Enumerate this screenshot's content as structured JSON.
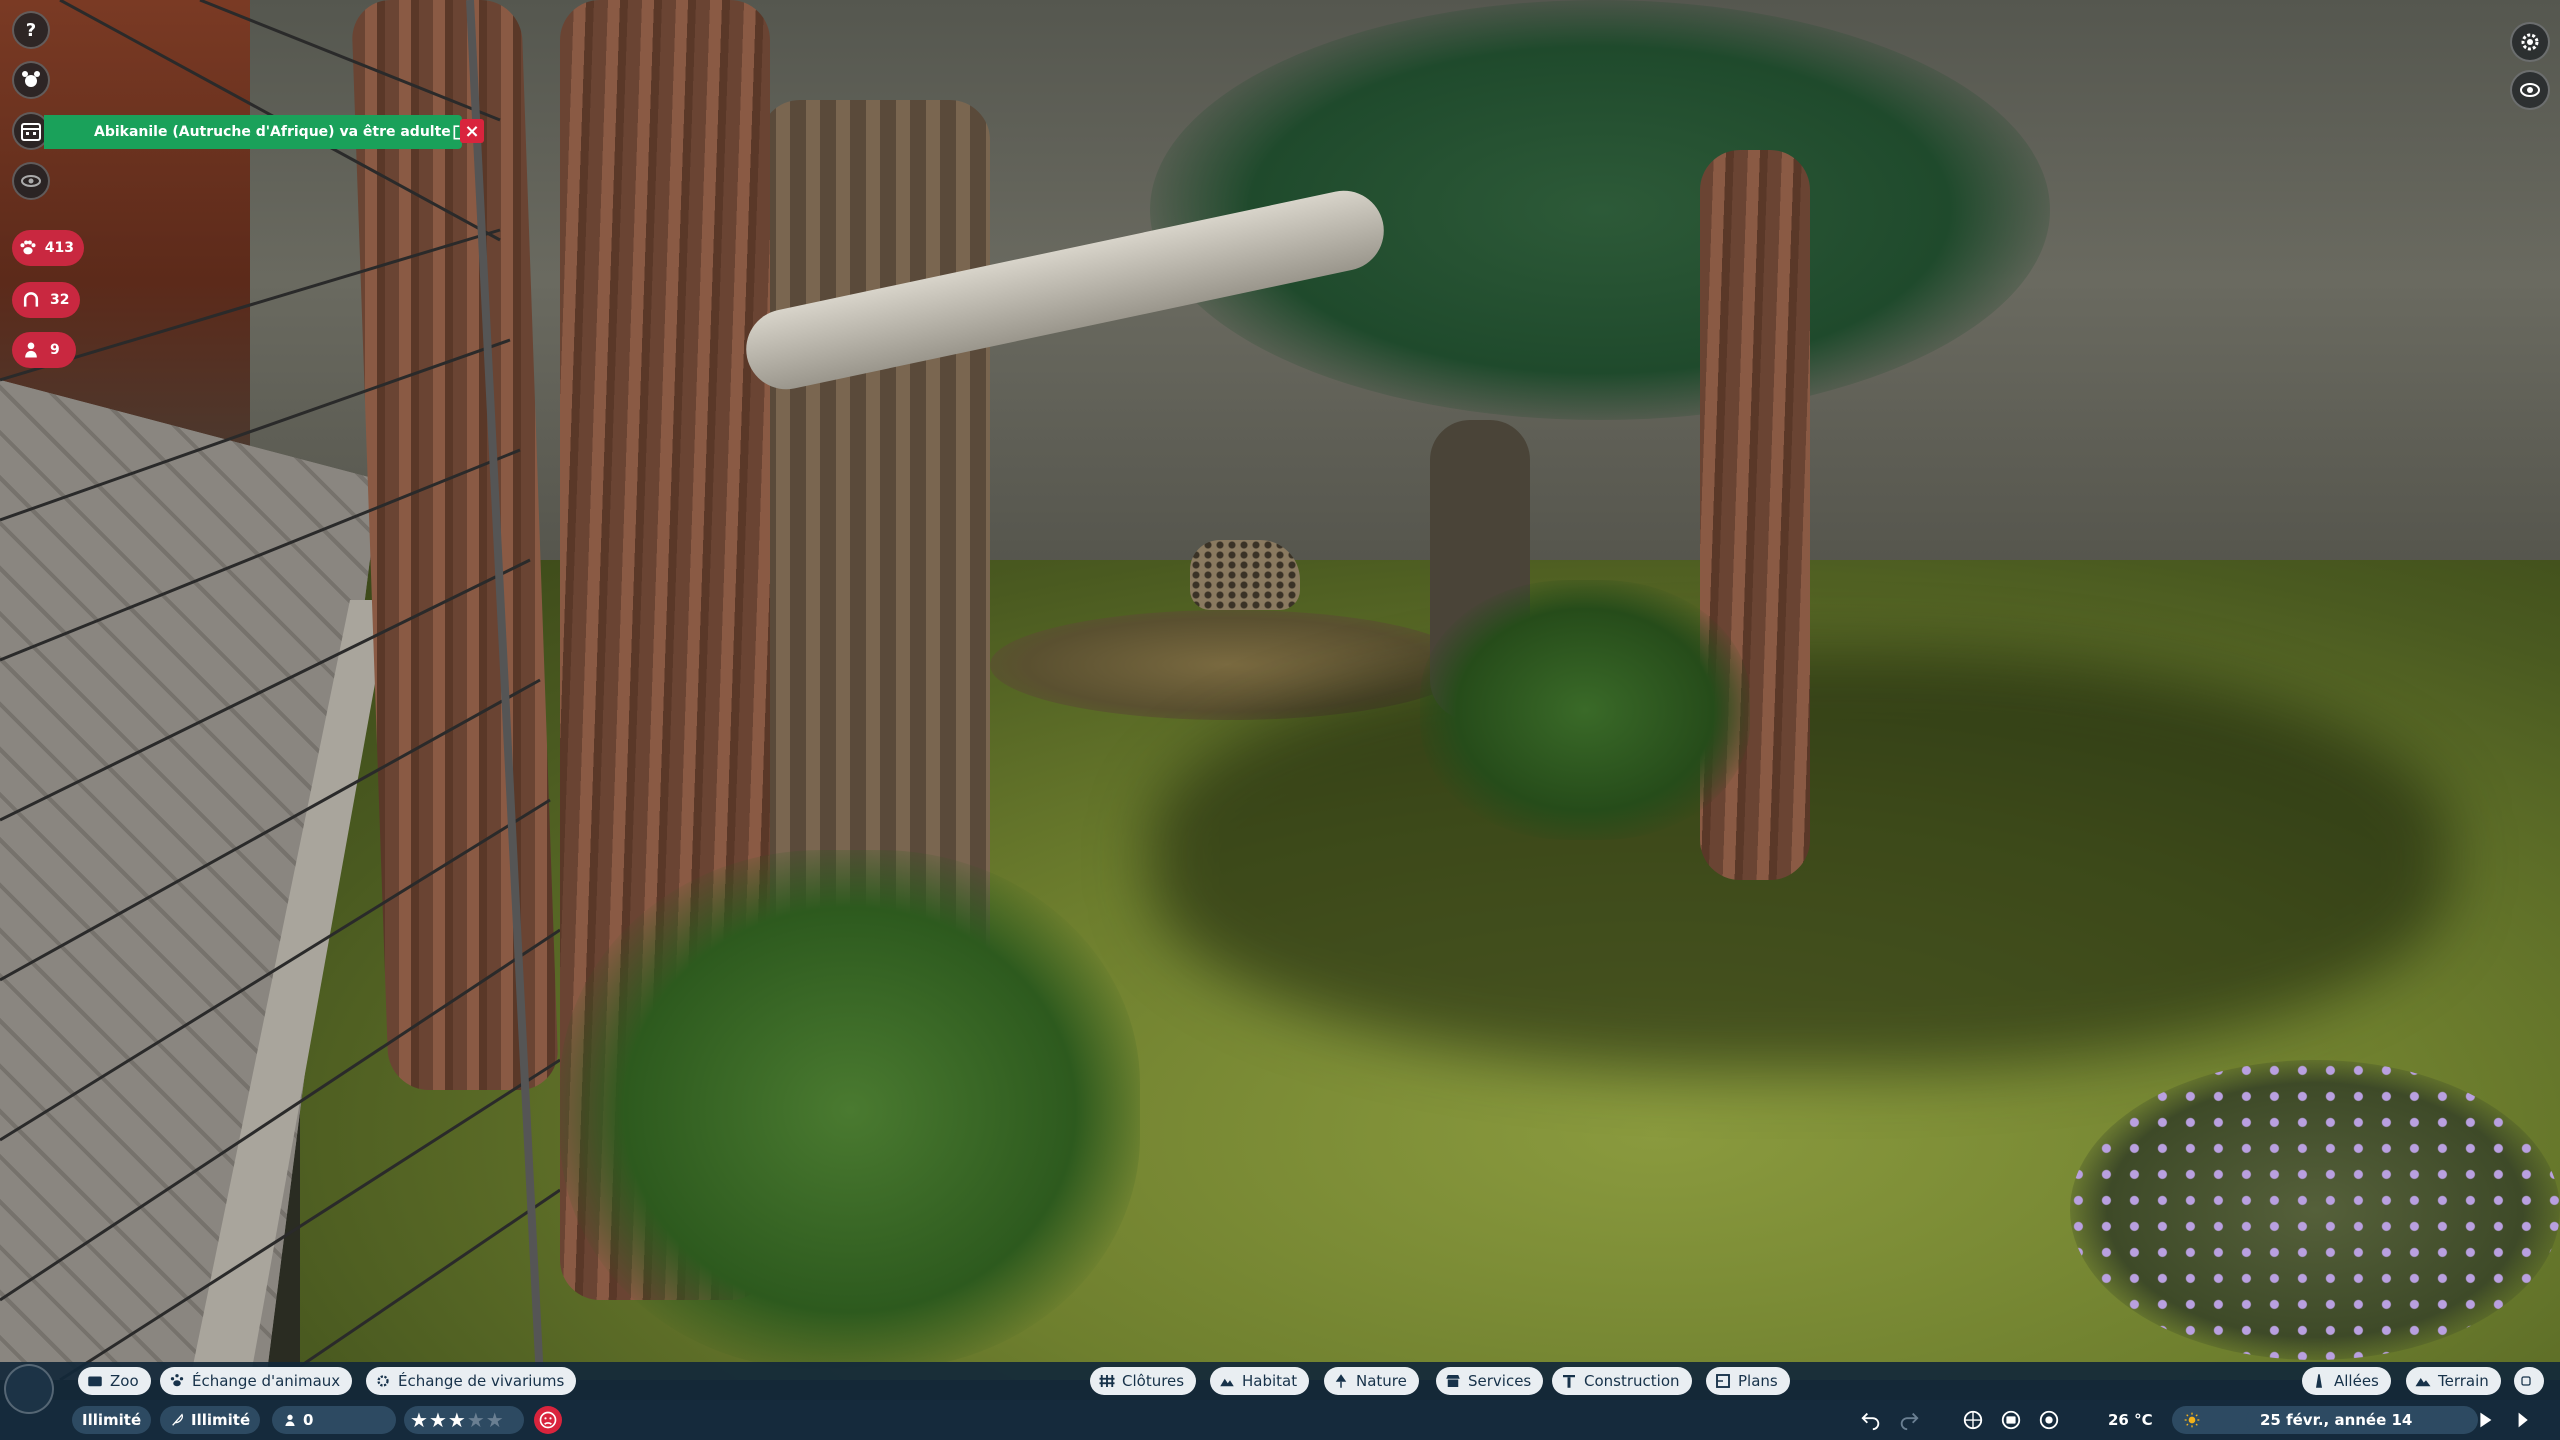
{
  "notification": {
    "text": "Abikanile (Autruche d'Afrique) va être adulte",
    "color": "#1aa15a"
  },
  "counters": [
    {
      "name": "animals",
      "icon": "paw-icon",
      "value": "413"
    },
    {
      "name": "guests",
      "icon": "horseshoe-icon",
      "value": "32"
    },
    {
      "name": "staff",
      "icon": "person-icon",
      "value": "9"
    }
  ],
  "toolbar_left": [
    {
      "id": "zoo",
      "icon": "zoo-icon",
      "label": "Zoo"
    },
    {
      "id": "animal-trade",
      "icon": "paw-icon",
      "label": "Échange d'animaux"
    },
    {
      "id": "vivarium-trade",
      "icon": "gear-icon",
      "label": "Échange de vivariums"
    }
  ],
  "toolbar_center": [
    {
      "id": "fences",
      "icon": "fence-icon",
      "label": "Clôtures"
    },
    {
      "id": "habitat",
      "icon": "habitat-icon",
      "label": "Habitat"
    },
    {
      "id": "nature",
      "icon": "tree-icon",
      "label": "Nature"
    },
    {
      "id": "services",
      "icon": "shop-icon",
      "label": "Services"
    },
    {
      "id": "construction",
      "icon": "beam-icon",
      "label": "Construction"
    },
    {
      "id": "plans",
      "icon": "blueprint-icon",
      "label": "Plans"
    }
  ],
  "toolbar_right": [
    {
      "id": "paths",
      "icon": "path-icon",
      "label": "Allées"
    },
    {
      "id": "terrain",
      "icon": "terrain-icon",
      "label": "Terrain"
    }
  ],
  "status": {
    "money": "Illimité",
    "research": "Illimité",
    "conservation": "0",
    "rating_stars": 3,
    "rating_max": 5,
    "temperature": "26 °C",
    "date": "25 févr., année 14"
  },
  "colors": {
    "bar": "#152a3c",
    "tab_bg": "#e9eef2",
    "accent_red": "#c92840"
  }
}
